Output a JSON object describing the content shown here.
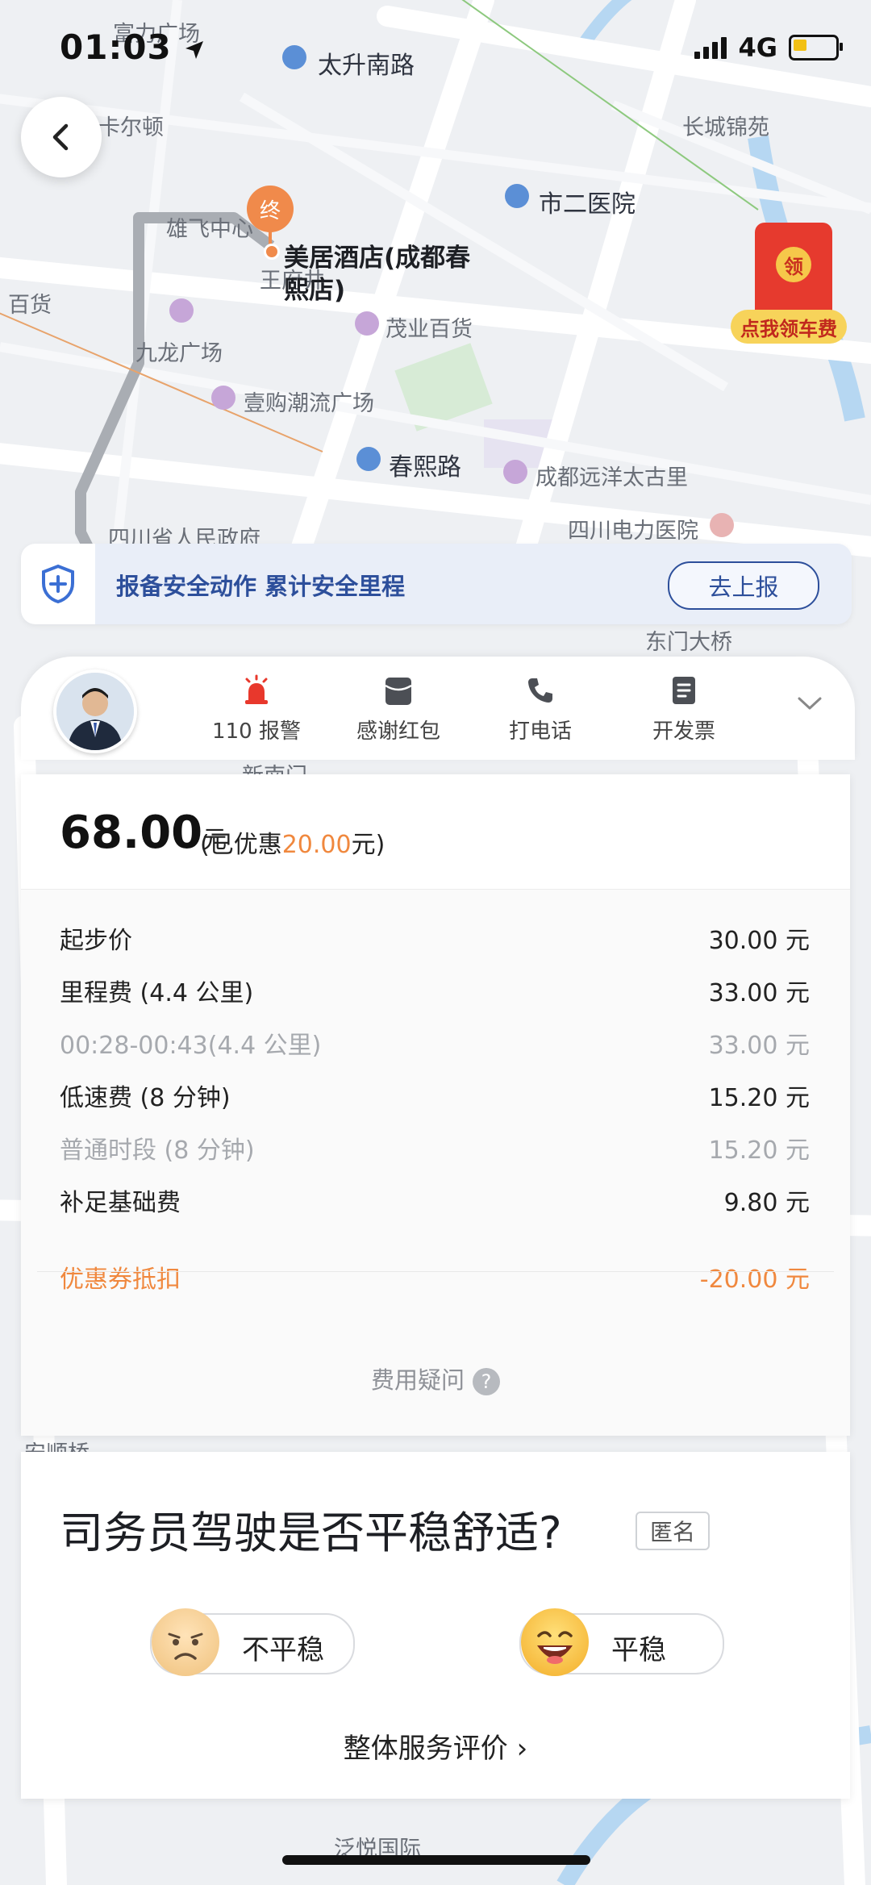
{
  "status": {
    "time": "01:03",
    "network": "4G"
  },
  "map": {
    "labels": {
      "taisheng_south_rd": "太升南路",
      "taisheng_south_rd_v": "太升南路",
      "changcheng": "长城锦苑",
      "shi_er_hospital": "市二医院",
      "jiulong": "九龙广场",
      "yigou": "壹购潮流广场",
      "maoye": "茂业百货",
      "chunxi_rd": "春熙路",
      "yuanyang": "成都远洋太古里",
      "sichuan_gov": "四川省人民政府",
      "power_hospital": "四川电力医院",
      "dongmen_bridge": "东门大桥",
      "kaerdun": "卡尔顿",
      "fuli_square": "富力广场",
      "xiongfei": "雄飞中心",
      "wangfujing": "王府井",
      "baihuo_left": "百货",
      "anshun": "安顺桥",
      "fanyue": "泛悦国际",
      "xinnan": "新南门"
    },
    "destination": {
      "pin_label": "终",
      "name": "美居酒店(成都春熙店)"
    },
    "red_packet": {
      "coin": "领",
      "label": "点我领车费"
    }
  },
  "safety_banner": {
    "text": "报备安全动作 累计安全里程",
    "button": "去上报"
  },
  "driver_actions": [
    {
      "label": "110 报警",
      "icon": "alarm-icon"
    },
    {
      "label": "感谢红包",
      "icon": "red-envelope-icon"
    },
    {
      "label": "打电话",
      "icon": "phone-icon"
    },
    {
      "label": "开发票",
      "icon": "invoice-icon"
    }
  ],
  "fare": {
    "total": "68.00",
    "unit": "元",
    "discount_prefix": "(已优惠",
    "discount_amount": "20.00",
    "discount_suffix": "元)",
    "rows": [
      {
        "label": "起步价",
        "value": "30.00 元",
        "sub": false
      },
      {
        "label": "里程费 (4.4 公里)",
        "value": "33.00 元",
        "sub": false
      },
      {
        "label": "00:28-00:43(4.4 公里)",
        "value": "33.00 元",
        "sub": true
      },
      {
        "label": "低速费 (8 分钟)",
        "value": "15.20 元",
        "sub": false
      },
      {
        "label": "普通时段 (8 分钟)",
        "value": "15.20 元",
        "sub": true
      },
      {
        "label": "补足基础费",
        "value": "9.80 元",
        "sub": false
      }
    ],
    "coupon": {
      "label": "优惠券抵扣",
      "value": "-20.00 元"
    },
    "fee_question": "费用疑问",
    "fee_question_icon": "?"
  },
  "rating": {
    "question": "司务员驾驶是否平稳舒适?",
    "anonymous": "匿名",
    "option_bad": "不平稳",
    "option_good": "平稳",
    "overall": "整体服务评价 ›"
  },
  "colors": {
    "accent_orange": "#f0883e",
    "brand_blue": "#2d4f9b"
  }
}
